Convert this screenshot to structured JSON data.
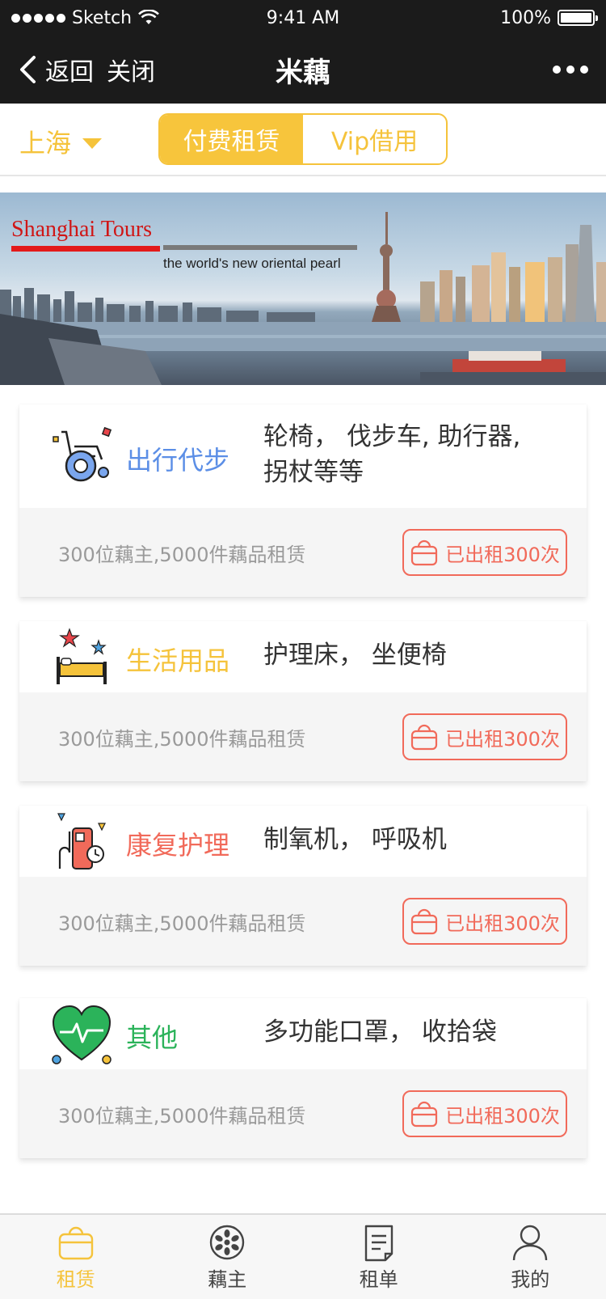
{
  "status_bar": {
    "carrier": "Sketch",
    "time": "9:41 AM",
    "battery": "100%"
  },
  "nav": {
    "back_label": "返回",
    "close_label": "关闭",
    "title": "米藕"
  },
  "filters": {
    "city": "上海",
    "tabs": [
      {
        "label": "付费租赁",
        "active": true
      },
      {
        "label": "Vip借用",
        "active": false
      }
    ]
  },
  "banner": {
    "title": "Shanghai Tours",
    "subtitle": "the world's new oriental pearl"
  },
  "categories": [
    {
      "name": "出行代步",
      "color": "#5b8ee6",
      "icon": "wheelchair-icon",
      "desc_line1": "轮椅， 伐步车, 助行器,",
      "desc_line2": "拐杖等等",
      "stats": "300位藕主,5000件藕品租赁",
      "rented": "已出租300次"
    },
    {
      "name": "生活用品",
      "color": "#f5c33b",
      "icon": "bed-icon",
      "desc_line1": "护理床， 坐便椅",
      "desc_line2": "",
      "stats": "300位藕主,5000件藕品租赁",
      "rented": "已出租300次"
    },
    {
      "name": "康复护理",
      "color": "#f16a5a",
      "icon": "oxygen-machine-icon",
      "desc_line1": "制氧机， 呼吸机",
      "desc_line2": "",
      "stats": "300位藕主,5000件藕品租赁",
      "rented": "已出租300次"
    },
    {
      "name": "其他",
      "color": "#2bb35a",
      "icon": "heart-pulse-icon",
      "desc_line1": "多功能口罩， 收拾袋",
      "desc_line2": "",
      "stats": "300位藕主,5000件藕品租赁",
      "rented": "已出租300次"
    }
  ],
  "tabbar": [
    {
      "label": "租赁",
      "icon": "bag-icon",
      "active": true
    },
    {
      "label": "藕主",
      "icon": "lotus-root-icon",
      "active": false
    },
    {
      "label": "租单",
      "icon": "order-list-icon",
      "active": false
    },
    {
      "label": "我的",
      "icon": "user-icon",
      "active": false
    }
  ],
  "colors": {
    "accent": "#f5c33b",
    "danger": "#f16a5a",
    "nav_bg": "#1b1b1b"
  }
}
